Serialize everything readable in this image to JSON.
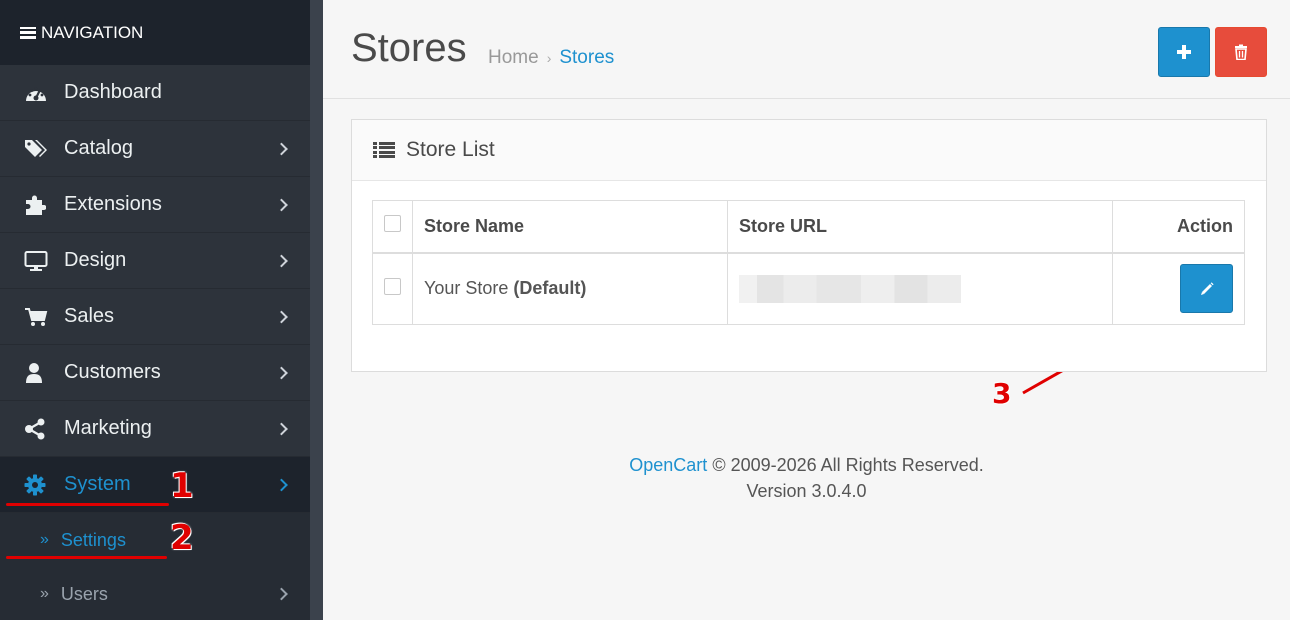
{
  "sidebar": {
    "header": "NAVIGATION",
    "items": [
      {
        "label": "Dashboard",
        "icon": "dashboard-icon"
      },
      {
        "label": "Catalog",
        "icon": "tags-icon"
      },
      {
        "label": "Extensions",
        "icon": "puzzle-icon"
      },
      {
        "label": "Design",
        "icon": "monitor-icon"
      },
      {
        "label": "Sales",
        "icon": "cart-icon"
      },
      {
        "label": "Customers",
        "icon": "user-icon"
      },
      {
        "label": "Marketing",
        "icon": "share-icon"
      },
      {
        "label": "System",
        "icon": "gear-icon"
      }
    ],
    "subitems": [
      {
        "label": "Settings"
      },
      {
        "label": "Users"
      }
    ]
  },
  "annotations": [
    "1",
    "2",
    "3"
  ],
  "header": {
    "title": "Stores",
    "breadcrumb": [
      "Home",
      "Stores"
    ]
  },
  "panel": {
    "title": "Store List",
    "columns": [
      "Store Name",
      "Store URL",
      "Action"
    ],
    "rows": [
      {
        "name": "Your Store",
        "default_label": "(Default)",
        "url": ""
      }
    ]
  },
  "footer": {
    "brand": "OpenCart",
    "copyright": "© 2009-2026 All Rights Reserved.",
    "version": "Version 3.0.4.0"
  },
  "colors": {
    "accent": "#1e91cf",
    "danger": "#e74c3c",
    "sidebar": "#2d333b",
    "annotation": "#e00000"
  }
}
